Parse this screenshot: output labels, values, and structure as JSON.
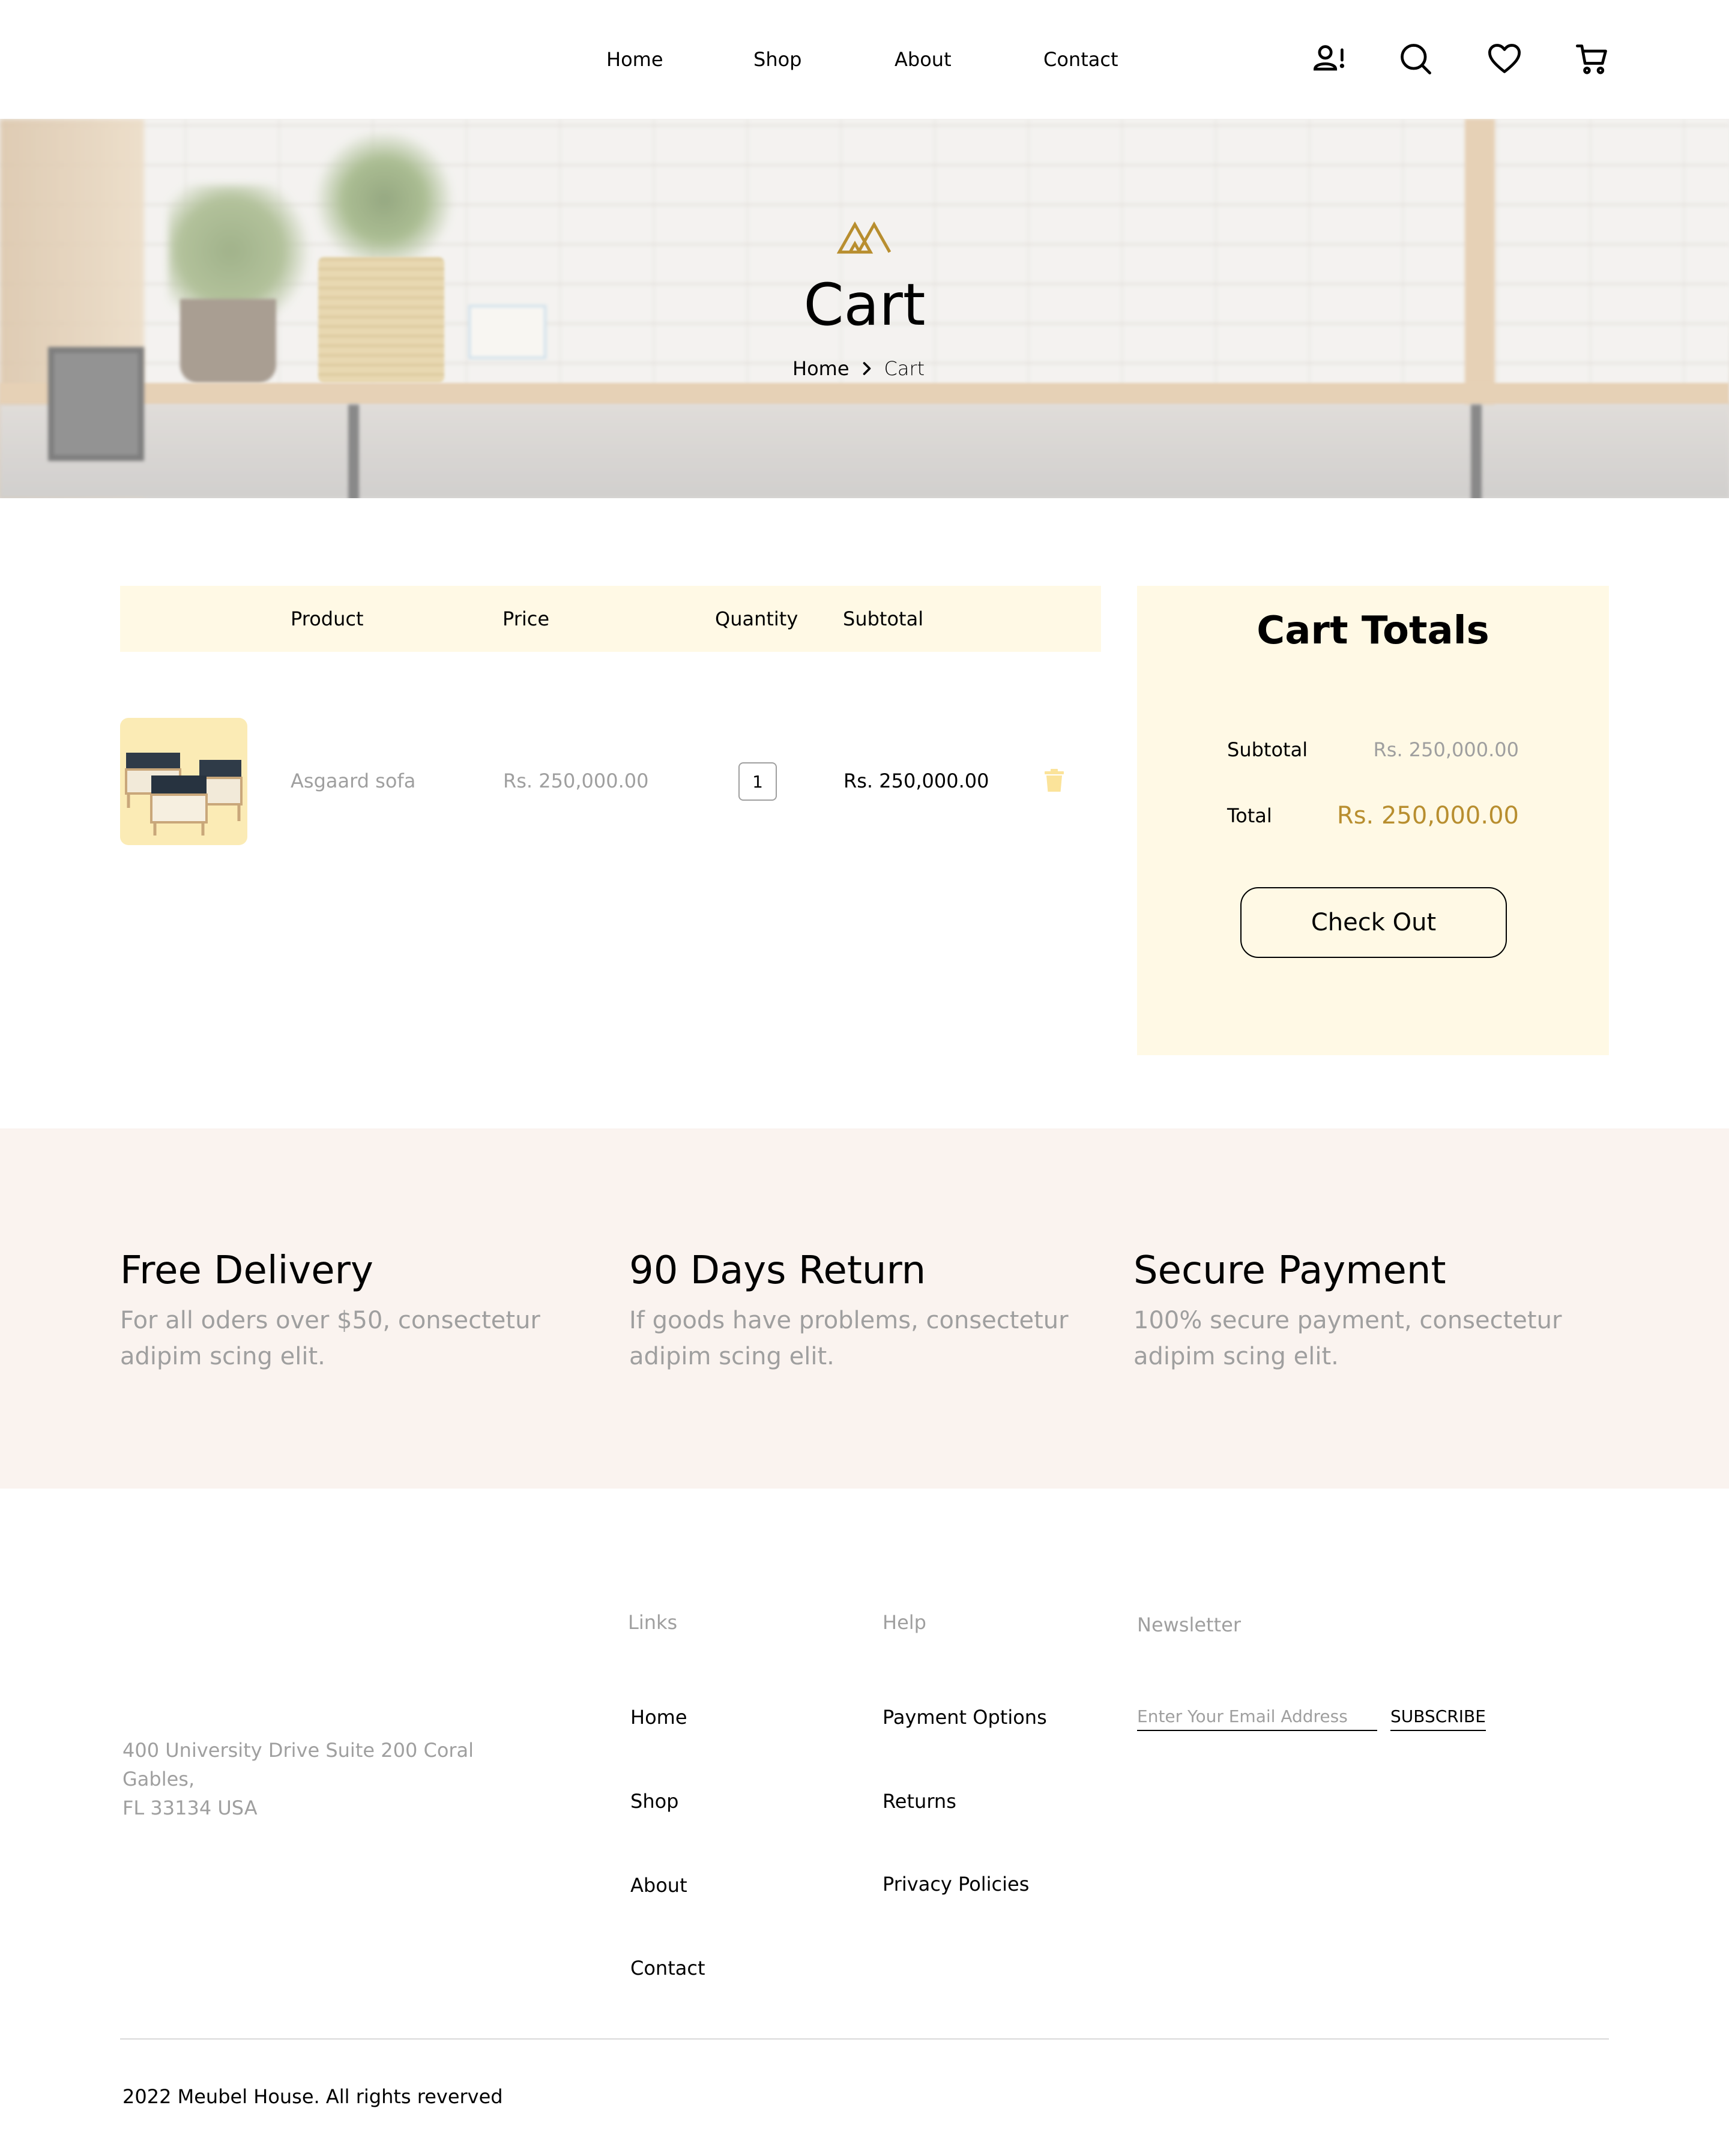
{
  "nav": {
    "links": [
      "Home",
      "Shop",
      "About",
      "Contact"
    ],
    "icons": [
      "account-alert-icon",
      "search-icon",
      "heart-icon",
      "cart-icon"
    ]
  },
  "hero": {
    "title": "Cart",
    "breadcrumb": {
      "home": "Home",
      "current": "Cart"
    }
  },
  "cart": {
    "headers": {
      "product": "Product",
      "price": "Price",
      "quantity": "Quantity",
      "subtotal": "Subtotal"
    },
    "items": [
      {
        "name": "Asgaard sofa",
        "price": "Rs. 250,000.00",
        "quantity": "1",
        "subtotal": "Rs. 250,000.00"
      }
    ]
  },
  "totals": {
    "title": "Cart Totals",
    "subtotal_label": "Subtotal",
    "subtotal_value": "Rs. 250,000.00",
    "total_label": "Total",
    "total_value": "Rs. 250,000.00",
    "checkout_label": "Check Out"
  },
  "features": [
    {
      "title": "Free Delivery",
      "desc": "For all oders over $50, consectetur adipim scing elit."
    },
    {
      "title": "90 Days Return",
      "desc": "If goods have problems, consectetur adipim scing elit."
    },
    {
      "title": "Secure Payment",
      "desc": "100% secure payment, consectetur adipim scing elit."
    }
  ],
  "footer": {
    "address": [
      "400 University Drive Suite 200 Coral",
      "Gables,",
      "FL 33134 USA"
    ],
    "links_title": "Links",
    "links": [
      "Home",
      "Shop",
      "About",
      "Contact"
    ],
    "help_title": "Help",
    "help": [
      "Payment Options",
      "Returns",
      "Privacy Policies"
    ],
    "newsletter_title": "Newsletter",
    "newsletter_placeholder": "Enter Your Email Address",
    "subscribe_label": "SUBSCRIBE",
    "copyright": "2022 Meubel House. All rights reverved"
  },
  "colors": {
    "accent": "#b88e2f",
    "cream": "#fff9e5",
    "muted": "#9f9f9f",
    "feature_bg": "#faf3ef"
  }
}
